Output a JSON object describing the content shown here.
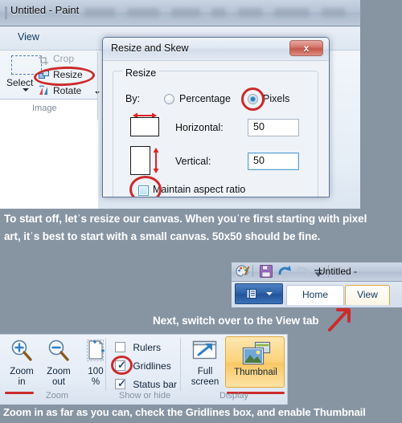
{
  "theme": {
    "page_background": "#8795a3",
    "annotation_red": "#cc2b2b",
    "accent_orange": "#e0a93a",
    "ribbon_blue": "#12375e"
  },
  "paint_window_1": {
    "title": "Untitled - Paint",
    "menu_tab": "View",
    "image_group": {
      "select_label": "Select",
      "crop_label": "Crop",
      "resize_label": "Resize",
      "rotate_label": "Rotate",
      "group_label": "Image"
    }
  },
  "resize_dialog": {
    "title": "Resize and Skew",
    "close_label": "x",
    "group_legend": "Resize",
    "by_label": "By:",
    "radio_percentage": "Percentage",
    "radio_pixels": "Pixels",
    "selected_radio": "Pixels",
    "horizontal_label": "Horizontal:",
    "horizontal_value": "50",
    "vertical_label": "Vertical:",
    "vertical_value": "50",
    "maintain_label": "Maintain aspect ratio",
    "maintain_checked": "false"
  },
  "annotation_1": "To start off, letˈs resize our canvas. When youˈre first starting with pixel art, itˈs best to start with a small canvas. 50x50 should be fine.",
  "annotation_2": "Next, switch over to the View tab",
  "annotation_3": "Zoom in as far as you can, check the Gridlines box, and enable Thumbnail",
  "paint_window_2": {
    "qat_title": "Untitled -",
    "qat_icons": [
      "paint-palette-icon",
      "save-icon",
      "undo-icon",
      "redo-icon",
      "customize-icon"
    ],
    "file_button": "file-menu-button",
    "tabs": [
      {
        "label": "Home",
        "state": "active"
      },
      {
        "label": "View",
        "state": "hover"
      }
    ]
  },
  "view_ribbon": {
    "zoom_group": {
      "label": "Zoom",
      "items": [
        {
          "line1": "Zoom",
          "line2": "in",
          "icon": "zoom-in-icon"
        },
        {
          "line1": "Zoom",
          "line2": "out",
          "icon": "zoom-out-icon"
        },
        {
          "line1": "100",
          "line2": "%",
          "icon": "actual-size-icon"
        }
      ]
    },
    "show_hide_group": {
      "label": "Show or hide",
      "items": [
        {
          "label": "Rulers",
          "checked": "false"
        },
        {
          "label": "Gridlines",
          "checked": "true"
        },
        {
          "label": "Status bar",
          "checked": "true"
        }
      ]
    },
    "display_group": {
      "label": "Display",
      "items": [
        {
          "line1": "Full",
          "line2": "screen",
          "icon": "full-screen-icon",
          "state": "normal"
        },
        {
          "line1": "Thumbnail",
          "line2": "",
          "icon": "thumbnail-icon",
          "state": "active"
        }
      ]
    }
  }
}
